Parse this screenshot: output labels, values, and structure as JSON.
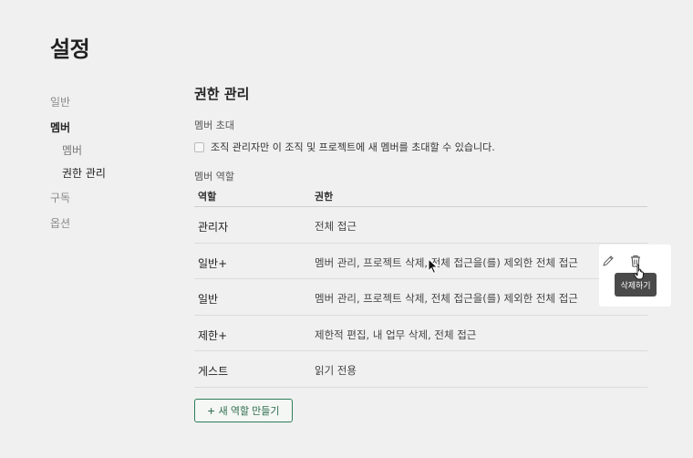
{
  "page": {
    "title": "설정"
  },
  "sidebar": {
    "items": [
      {
        "label": "일반",
        "active": false
      },
      {
        "label": "멤버",
        "active": true
      },
      {
        "label": "멤버",
        "active": false,
        "sub": true
      },
      {
        "label": "권한 관리",
        "active": true,
        "sub": true
      },
      {
        "label": "구독",
        "active": false
      },
      {
        "label": "옵션",
        "active": false
      }
    ]
  },
  "main": {
    "section_title": "권한 관리",
    "invite": {
      "label": "멤버 초대",
      "checkbox_label": "조직 관리자만 이 조직 및 프로젝트에 새 멤버를 초대할 수 있습니다.",
      "checked": false
    },
    "roles": {
      "label": "멤버 역할",
      "columns": [
        "역할",
        "권한"
      ],
      "rows": [
        {
          "role": "관리자",
          "permission": "전체 접근"
        },
        {
          "role": "일반+",
          "permission": "멤버 관리, 프로젝트 삭제, 전체 접근을(를) 제외한 전체 접근"
        },
        {
          "role": "일반",
          "permission": "멤버 관리, 프로젝트 삭제, 전체 접근을(를) 제외한 전체 접근"
        },
        {
          "role": "제한+",
          "permission": "제한적 편집, 내 업무 삭제, 전체 접근"
        },
        {
          "role": "게스트",
          "permission": "읽기 전용"
        }
      ]
    },
    "add_role_label": "새 역할 만들기"
  },
  "popover": {
    "edit_icon": "pencil-icon",
    "delete_icon": "trash-icon",
    "tooltip": "삭제하기"
  },
  "colors": {
    "background": "#f0f0f0",
    "accent": "#2f7d57",
    "tooltip_bg": "#4a4a4a"
  }
}
